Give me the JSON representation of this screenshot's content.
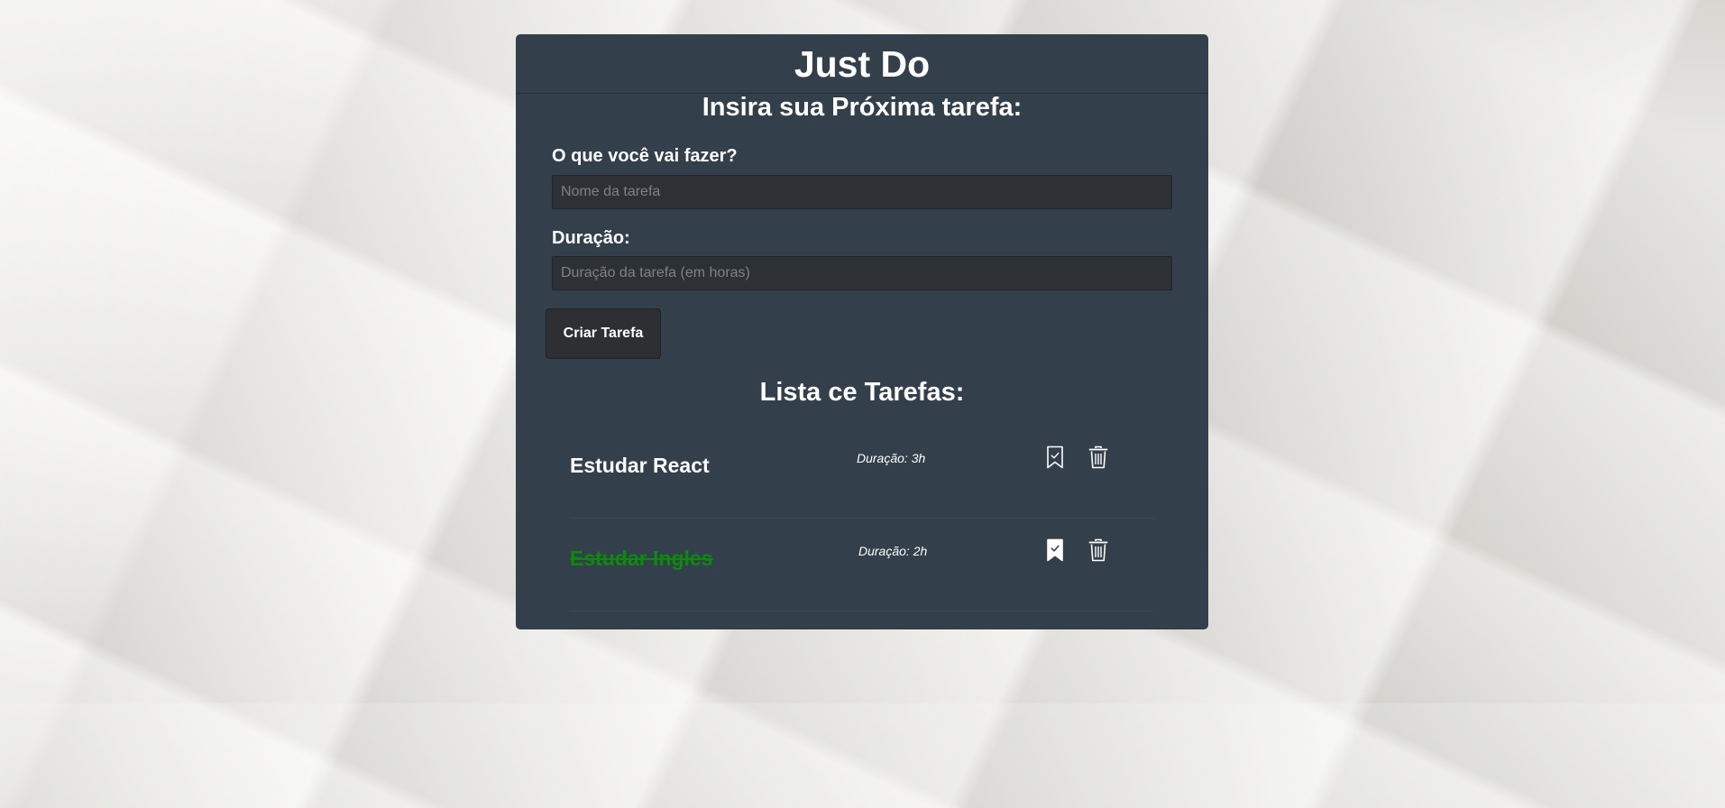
{
  "app": {
    "title": "Just Do"
  },
  "form": {
    "title": "Insira sua Próxima tarefa:",
    "task_label": "O que você vai fazer?",
    "task_placeholder": "Nome da tarefa",
    "task_value": "",
    "duration_label": "Duração:",
    "duration_placeholder": "Duração da tarefa (em horas)",
    "duration_value": "",
    "submit_label": "Criar Tarefa"
  },
  "list": {
    "title": "Lista ce Tarefas:",
    "tasks": [
      {
        "name": "Estudar React",
        "duration": "Duração: 3h",
        "completed": false,
        "icons": [
          "bookmark-outline-icon",
          "trash-icon"
        ]
      },
      {
        "name": "Estudar Ingles",
        "duration": "Duração: 2h",
        "completed": true,
        "icons": [
          "bookmark-filled-icon",
          "trash-icon"
        ]
      }
    ]
  },
  "colors": {
    "panel": "#333f4a",
    "completed_task": "#0d8a0d",
    "input_bg": "#2d3035",
    "button_bg": "#2d2f32"
  }
}
